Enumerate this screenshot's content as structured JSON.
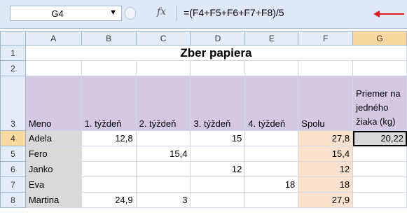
{
  "formula_bar": {
    "cell_ref": "G4",
    "fx": "fx",
    "formula": "=(F4+F5+F6+F7+F8)/5"
  },
  "columns": [
    "A",
    "B",
    "C",
    "D",
    "E",
    "F",
    "G"
  ],
  "title": "Zber papiera",
  "headers": {
    "meno": "Meno",
    "w1": "1. týždeň",
    "w2": "2. týždeň",
    "w3": "3. týždeň",
    "w4": "4. týždeň",
    "spolu": "Spolu",
    "priemer": "Priemer na jedného žiaka (kg)"
  },
  "rows": [
    {
      "num": "4",
      "name": "Adela",
      "w1": "12,8",
      "w2": "",
      "w3": "15",
      "w4": "",
      "total": "27,8",
      "avg": "20,22"
    },
    {
      "num": "5",
      "name": "Fero",
      "w1": "",
      "w2": "15,4",
      "w3": "",
      "w4": "",
      "total": "15,4",
      "avg": ""
    },
    {
      "num": "6",
      "name": "Janko",
      "w1": "",
      "w2": "",
      "w3": "12",
      "w4": "",
      "total": "12",
      "avg": ""
    },
    {
      "num": "7",
      "name": "Eva",
      "w1": "",
      "w2": "",
      "w3": "",
      "w4": "18",
      "total": "18",
      "avg": ""
    },
    {
      "num": "8",
      "name": "Martina",
      "w1": "24,9",
      "w2": "3",
      "w3": "",
      "w4": "",
      "total": "27,9",
      "avg": ""
    }
  ],
  "row_numbers": {
    "r1": "1",
    "r2": "2",
    "r3": "3"
  }
}
